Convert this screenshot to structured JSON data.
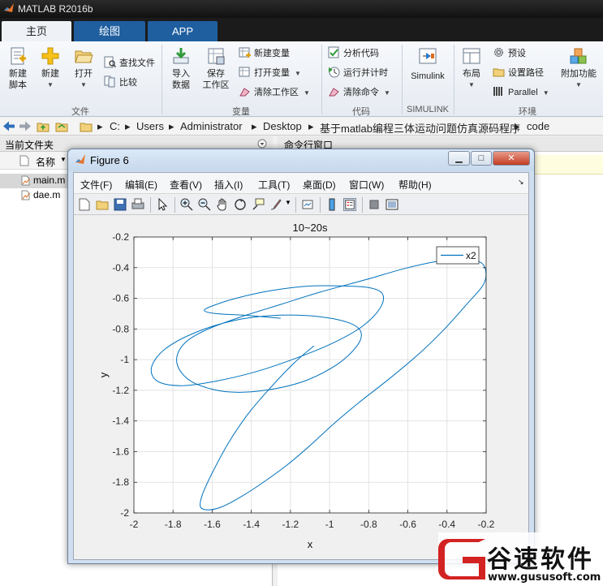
{
  "window": {
    "title": "MATLAB R2016b"
  },
  "tabs": [
    {
      "label": "主页"
    },
    {
      "label": "绘图"
    },
    {
      "label": "APP"
    }
  ],
  "ribbon": {
    "file": {
      "new_script": [
        "新建",
        "脚本"
      ],
      "new": "新建",
      "open": "打开",
      "find_files": "查找文件",
      "compare": "比较",
      "group": "文件"
    },
    "variable": {
      "import": [
        "导入",
        "数据"
      ],
      "save": [
        "保存",
        "工作区"
      ],
      "new_var": "新建变量",
      "open_var": "打开变量",
      "clear_ws": "清除工作区",
      "group": "变量"
    },
    "code": {
      "analyze": "分析代码",
      "run_time": "运行并计时",
      "clear_cmd": "清除命令",
      "group": "代码"
    },
    "simulink": {
      "label": "Simulink",
      "group": "SIMULINK"
    },
    "env": {
      "layout": "布局",
      "prefs": "预设",
      "set_path": "设置路径",
      "parallel": "Parallel",
      "addons": "附加功能",
      "group": "环境"
    }
  },
  "path": {
    "segments": [
      "C:",
      "Users",
      "Administrator",
      "Desktop",
      "基于matlab编程三体运动问题仿真源码程序",
      "code"
    ]
  },
  "left_panel": {
    "title": "当前文件夹",
    "column_name": "名称",
    "files": [
      {
        "name": "main.m"
      },
      {
        "name": "dae.m"
      }
    ]
  },
  "right_panel": {
    "title": "命令行窗口"
  },
  "figure": {
    "title": "Figure 6",
    "menu": [
      "文件(F)",
      "编辑(E)",
      "查看(V)",
      "插入(I)",
      "工具(T)",
      "桌面(D)",
      "窗口(W)",
      "帮助(H)"
    ]
  },
  "chart_data": {
    "type": "line",
    "title": "10~20s",
    "xlabel": "x",
    "ylabel": "y",
    "xlim": [
      -2,
      -0.2
    ],
    "ylim": [
      -2,
      -0.2
    ],
    "xticks": [
      -2,
      -1.8,
      -1.6,
      -1.4,
      -1.2,
      -1,
      -0.8,
      -0.6,
      -0.4,
      -0.2
    ],
    "yticks": [
      -0.2,
      -0.4,
      -0.6,
      -0.8,
      -1,
      -1.2,
      -1.4,
      -1.6,
      -1.8,
      -2
    ],
    "xtick_labels": [
      "-2",
      "-1.8",
      "-1.6",
      "-1.4",
      "-1.2",
      "-1",
      "-0.8",
      "-0.6",
      "-0.4",
      "-0.2"
    ],
    "ytick_labels": [
      "-0.2",
      "-0.4",
      "-0.6",
      "-0.8",
      "-1",
      "-1.2",
      "-1.4",
      "-1.6",
      "-1.8",
      "-2"
    ],
    "grid": true,
    "legend_position": "top-right",
    "series": [
      {
        "name": "x2",
        "color": "#0072bd",
        "x": [
          -1.08,
          -1.18,
          -1.3,
          -1.42,
          -1.52,
          -1.6,
          -1.65,
          -1.66,
          -1.62,
          -1.55,
          -1.46,
          -1.35,
          -1.22,
          -1.1,
          -0.98,
          -0.85,
          -0.7,
          -0.55,
          -0.42,
          -0.3,
          -0.21,
          -0.21,
          -0.27,
          -0.4,
          -0.6,
          -0.82,
          -1.05,
          -1.25,
          -1.45,
          -1.62,
          -1.73,
          -1.78,
          -1.76,
          -1.68,
          -1.52,
          -1.33,
          -1.13,
          -0.96,
          -0.86,
          -0.84,
          -0.9,
          -1.05,
          -1.25,
          -1.47,
          -1.68,
          -1.84,
          -1.91,
          -1.88,
          -1.76,
          -1.58,
          -1.38,
          -1.17,
          -0.98,
          -0.83,
          -0.74,
          -0.73,
          -0.8,
          -0.92,
          -1.1,
          -1.3,
          -1.48,
          -1.6,
          -1.64,
          -1.58,
          -1.44,
          -1.25
        ],
        "y": [
          -0.91,
          -1.02,
          -1.18,
          -1.36,
          -1.55,
          -1.74,
          -1.88,
          -1.96,
          -1.98,
          -1.96,
          -1.9,
          -1.81,
          -1.69,
          -1.56,
          -1.42,
          -1.28,
          -1.13,
          -0.97,
          -0.81,
          -0.64,
          -0.5,
          -0.39,
          -0.35,
          -0.35,
          -0.4,
          -0.48,
          -0.56,
          -0.64,
          -0.72,
          -0.8,
          -0.88,
          -0.98,
          -1.08,
          -1.16,
          -1.21,
          -1.2,
          -1.14,
          -1.03,
          -0.91,
          -0.82,
          -0.76,
          -0.72,
          -0.71,
          -0.74,
          -0.82,
          -0.93,
          -1.05,
          -1.14,
          -1.17,
          -1.14,
          -1.08,
          -0.99,
          -0.89,
          -0.78,
          -0.66,
          -0.57,
          -0.53,
          -0.52,
          -0.52,
          -0.55,
          -0.6,
          -0.65,
          -0.68,
          -0.7,
          -0.71,
          -0.73
        ]
      }
    ]
  },
  "watermark": {
    "text": "谷速软件",
    "url": "www.gususoft.com"
  }
}
